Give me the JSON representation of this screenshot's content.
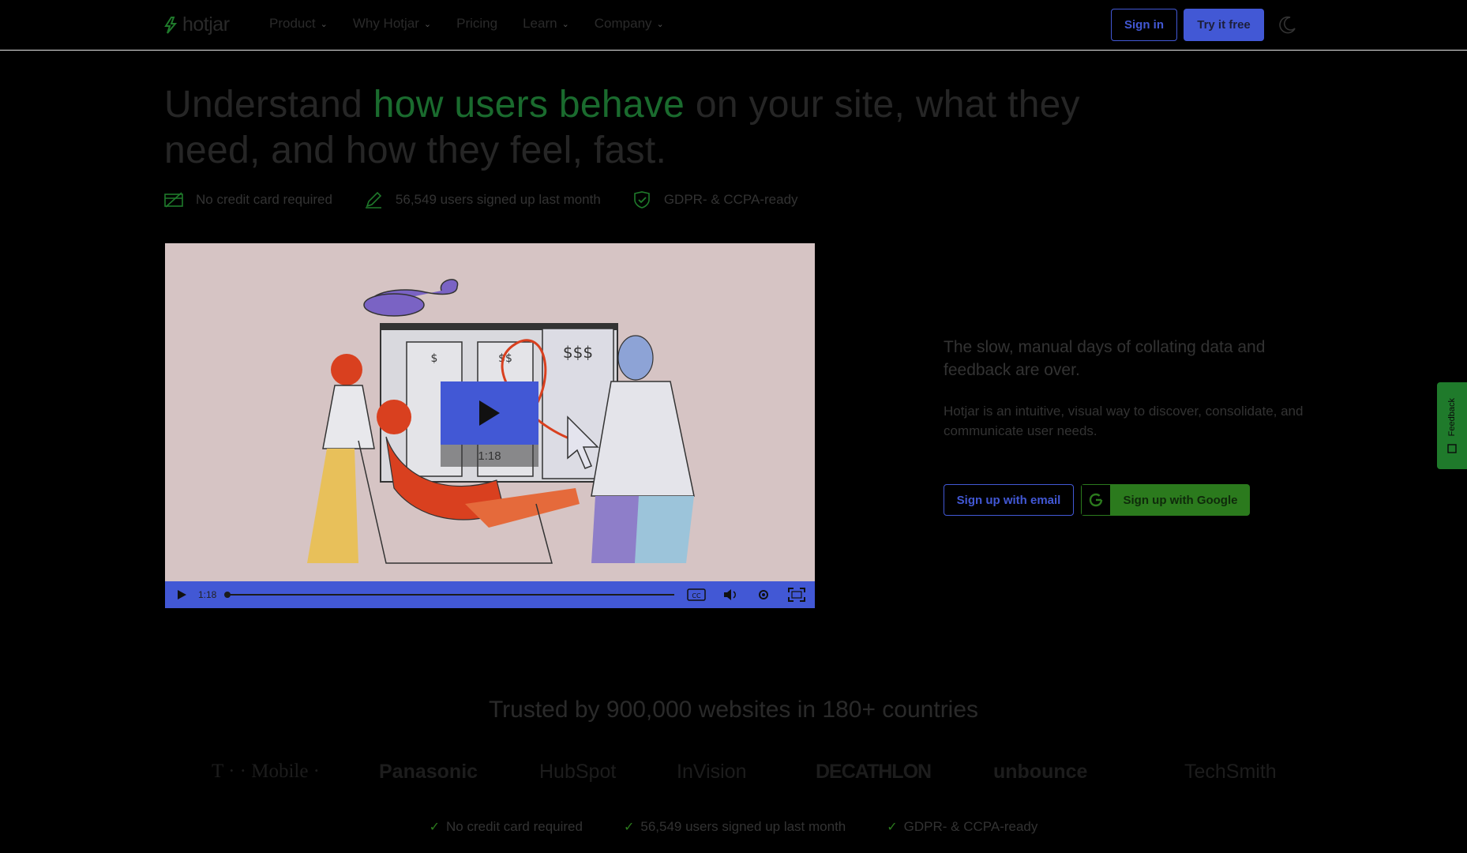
{
  "nav": {
    "logo_text": "hotjar",
    "items": [
      {
        "label": "Product",
        "has_dropdown": true
      },
      {
        "label": "Why Hotjar",
        "has_dropdown": true
      },
      {
        "label": "Pricing",
        "has_dropdown": false
      },
      {
        "label": "Learn",
        "has_dropdown": true
      },
      {
        "label": "Company",
        "has_dropdown": true
      }
    ],
    "sign_in_label": "Sign in",
    "try_label": "Try it free",
    "theme_icon": "moon-icon"
  },
  "hero": {
    "headline_pre": "Understand ",
    "headline_accent": "how users behave",
    "headline_post": " on your site, what they need, and how they feel, fast.",
    "badges": [
      {
        "icon": "credit-card-icon",
        "text": "No credit card required"
      },
      {
        "icon": "pencil-icon",
        "text": "56,549 users signed up last month"
      },
      {
        "icon": "shield-check-icon",
        "text": "GDPR- & CCPA-ready"
      }
    ]
  },
  "video": {
    "duration": "1:18",
    "controls_time": "1:18",
    "price_labels": [
      "$",
      "$$",
      "$$$"
    ],
    "progress": 0
  },
  "copy": {
    "lead": "The slow, manual days of collating data and feedback are over.",
    "body": "Hotjar is an intuitive, visual way to discover, consolidate, and communicate user needs.",
    "signup_email_label": "Sign up with email",
    "signup_google_label": "Sign up with Google"
  },
  "feedback_tab": {
    "label": "Feedback"
  },
  "trust": {
    "title": "Trusted by 900,000 websites in 180+ countries",
    "logos": [
      "T · · Mobile ·",
      "Panasonic",
      "HubSpot",
      "InVision",
      "DECATHLON",
      "unbounce",
      "TechSmith"
    ],
    "checks": [
      "No credit card required",
      "56,549 users signed up last month",
      "GDPR- & CCPA-ready"
    ]
  },
  "colors": {
    "accent_blue": "#4258d5",
    "accent_green": "#1a6b2e",
    "google_green": "#2b7a1d",
    "background": "#000000"
  }
}
